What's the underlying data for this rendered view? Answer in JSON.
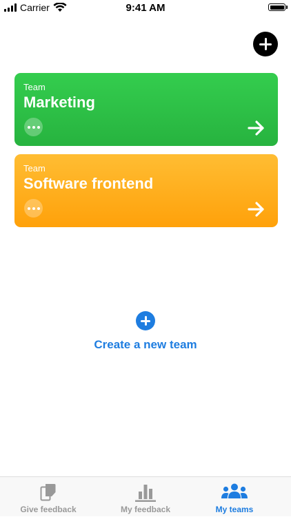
{
  "status_bar": {
    "carrier": "Carrier",
    "time": "9:41 AM",
    "icons": [
      "cellular-signal-icon",
      "wifi-icon",
      "battery-icon"
    ]
  },
  "header": {
    "add_icon": "plus-icon"
  },
  "teams": [
    {
      "eyebrow": "Team",
      "name": "Marketing",
      "color": "#2fc249",
      "more_icon": "ellipsis-icon",
      "open_icon": "arrow-right-icon"
    },
    {
      "eyebrow": "Team",
      "name": "Software frontend",
      "color": "#ffad1f",
      "more_icon": "ellipsis-icon",
      "open_icon": "arrow-right-icon"
    }
  ],
  "create_team": {
    "icon": "plus-icon",
    "label": "Create a new team"
  },
  "tab_bar": {
    "tabs": [
      {
        "label": "Give feedback",
        "icon": "feedback-cards-icon",
        "active": false
      },
      {
        "label": "My feedback",
        "icon": "bar-chart-icon",
        "active": false
      },
      {
        "label": "My teams",
        "icon": "people-icon",
        "active": true
      }
    ]
  },
  "colors": {
    "accent": "#1e7de0",
    "inactive_tab": "#999999"
  }
}
